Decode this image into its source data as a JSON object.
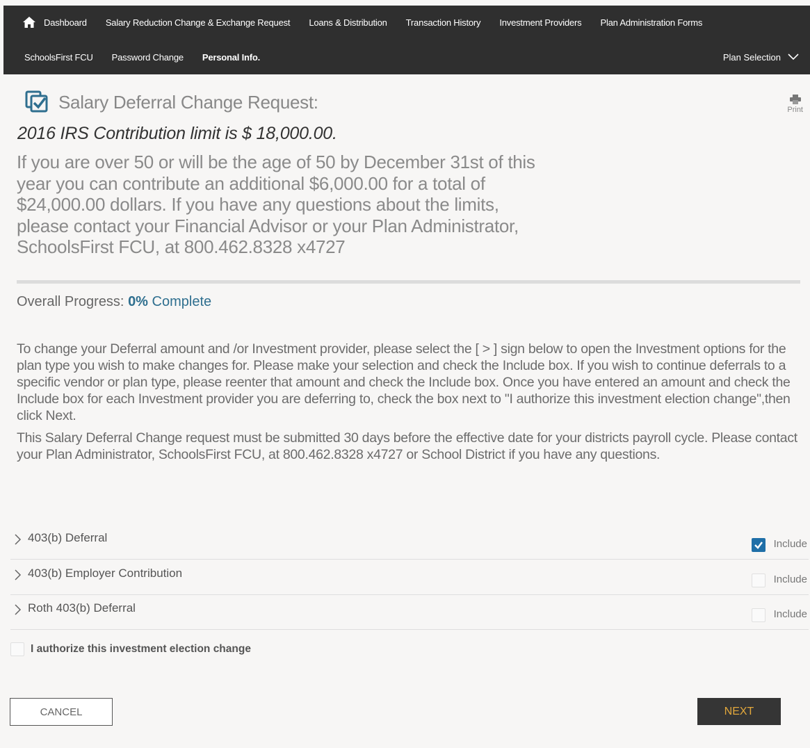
{
  "nav": {
    "row1": [
      "Dashboard",
      "Salary Reduction Change & Exchange Request",
      "Loans & Distribution",
      "Transaction History",
      "Investment Providers",
      "Plan Administration Forms"
    ],
    "row2": [
      "SchoolsFirst FCU",
      "Password Change",
      "Personal Info."
    ],
    "plan_selection": "Plan Selection"
  },
  "page": {
    "title": "Salary Deferral Change Request:",
    "print_label": "Print",
    "limit_heading": "2016 IRS Contribution limit is $ 18,000.00.",
    "limit_description": "If you are over 50 or will be the age of 50 by December 31st of this year you can contribute an additional $6,000.00 for a total of $24,000.00 dollars. If you have any questions about the limits, please contact your Financial Advisor or your Plan Administrator, SchoolsFirst FCU, at 800.462.8328 x4727"
  },
  "progress": {
    "label": "Overall Progress:",
    "percent": "0%",
    "complete_text": "Complete"
  },
  "instructions": {
    "p1": "To change your Deferral amount and /or Investment provider, please select the [ > ] sign below to open the Investment options for the plan type you wish to make changes for. Please make your selection and check the Include box. If you wish to continue deferrals to a specific vendor or plan type, please reenter that amount and check the Include box. Once you have entered an amount and check the Include box for each Investment provider you are deferring to, check the box next to \"I authorize this investment election change\",then click Next.",
    "p2": "This Salary Deferral Change request must be submitted 30 days before the effective date for your districts payroll cycle. Please contact your Plan Administrator, SchoolsFirst FCU, at 800.462.8328 x4727 or School District if you have any questions."
  },
  "plans": [
    {
      "label": "403(b) Deferral",
      "include_label": "Include",
      "included": true
    },
    {
      "label": "403(b) Employer Contribution",
      "include_label": "Include",
      "included": false
    },
    {
      "label": "Roth 403(b) Deferral",
      "include_label": "Include",
      "included": false
    }
  ],
  "authorize": {
    "label": "I authorize this investment election change",
    "checked": false
  },
  "buttons": {
    "cancel": "CANCEL",
    "next": "NEXT"
  },
  "colors": {
    "navbar": "#2f2f2f",
    "accent": "#2f6f8f",
    "checkbox_checked": "#1f6fa8",
    "next_text": "#e3a83c"
  },
  "icons": {
    "home": "home-icon",
    "title": "checklist-icon",
    "print": "printer-icon",
    "plan_selection": "chevron-down-icon",
    "expand": "chevron-right-icon"
  }
}
